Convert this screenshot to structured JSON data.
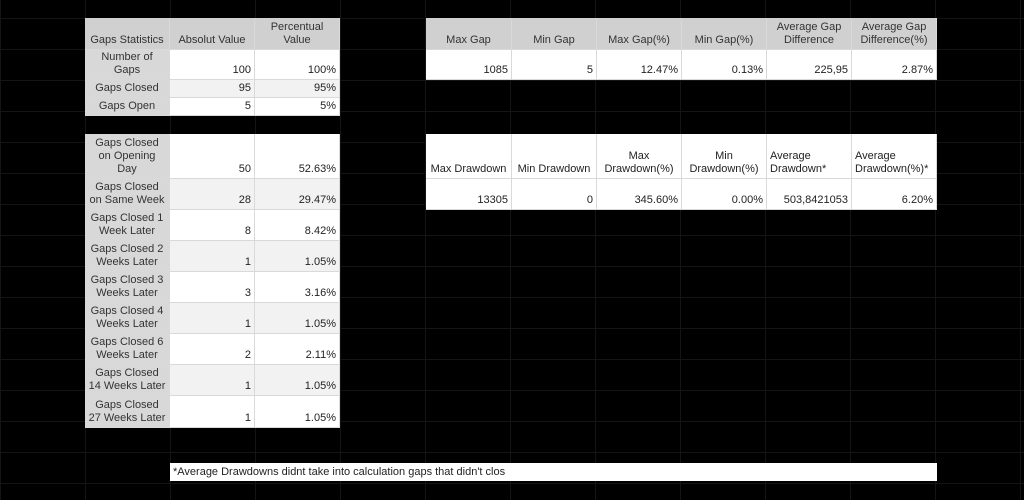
{
  "gaps_table": {
    "headers": [
      "Gaps Statistics",
      "Absolut Value",
      "Percentual Value"
    ],
    "rows": [
      {
        "label": "Number of Gaps",
        "absolute": "100",
        "percent": "100%"
      },
      {
        "label": "Gaps Closed",
        "absolute": "95",
        "percent": "95%"
      },
      {
        "label": "Gaps Open",
        "absolute": "5",
        "percent": "5%"
      }
    ]
  },
  "closing_table": {
    "rows": [
      {
        "label": "Gaps Closed on Opening Day",
        "absolute": "50",
        "percent": "52.63%"
      },
      {
        "label": "Gaps Closed on Same Week",
        "absolute": "28",
        "percent": "29.47%"
      },
      {
        "label": "Gaps Closed 1 Week Later",
        "absolute": "8",
        "percent": "8.42%"
      },
      {
        "label": "Gaps Closed 2 Weeks Later",
        "absolute": "1",
        "percent": "1.05%"
      },
      {
        "label": "Gaps Closed 3 Weeks Later",
        "absolute": "3",
        "percent": "3.16%"
      },
      {
        "label": "Gaps Closed 4 Weeks Later",
        "absolute": "1",
        "percent": "1.05%"
      },
      {
        "label": "Gaps Closed 6 Weeks Later",
        "absolute": "2",
        "percent": "2.11%"
      },
      {
        "label": "Gaps Closed 14 Weeks Later",
        "absolute": "1",
        "percent": "1.05%"
      },
      {
        "label": "Gaps Closed 27 Weeks Later",
        "absolute": "1",
        "percent": "1.05%"
      }
    ]
  },
  "gap_size_table": {
    "headers": [
      "Max Gap",
      "Min Gap",
      "Max Gap(%)",
      "Min Gap(%)",
      "Average Gap Difference",
      "Average Gap Difference(%)"
    ],
    "values": [
      "1085",
      "5",
      "12.47%",
      "0.13%",
      "225,95",
      "2.87%"
    ]
  },
  "drawdown_table": {
    "headers": [
      "Max Drawdown",
      "Min Drawdown",
      "Max Drawdown(%)",
      "Min Drawdown(%)",
      "Average Drawdown*",
      "Average Drawdown(%)*"
    ],
    "values": [
      "13305",
      "0",
      "345.60%",
      "0.00%",
      "503,8421053",
      "6.20%"
    ]
  },
  "footnote": "*Average Drawdowns didnt take into calculation gaps that didn't clos"
}
